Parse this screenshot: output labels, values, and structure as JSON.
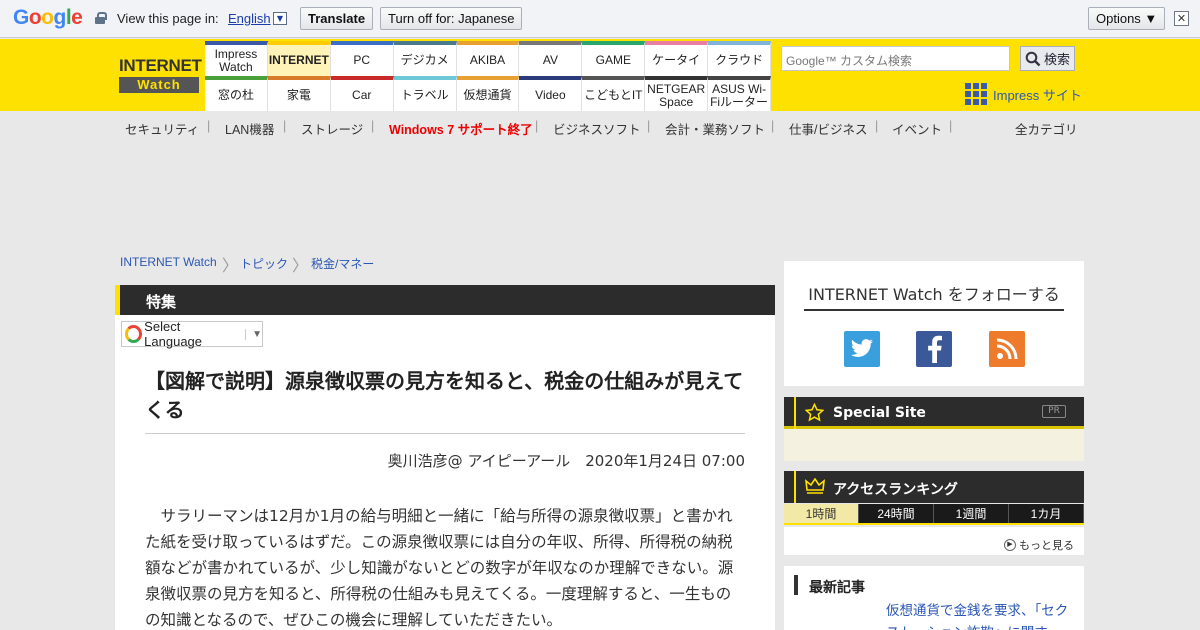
{
  "translate_bar": {
    "logo": [
      "G",
      "o",
      "o",
      "g",
      "l",
      "e"
    ],
    "view_label": "View this page in:",
    "language": "English",
    "translate_button": "Translate",
    "turn_off_button": "Turn off for: Japanese",
    "options_button": "Options ▼",
    "close_glyph": "✕"
  },
  "header": {
    "logo_top": "INTERNET",
    "logo_bottom": "Watch",
    "nav_row1": [
      {
        "label": "Impress Watch",
        "color": "#3a5aa8"
      },
      {
        "label": "INTERNET",
        "color": "#ffcc00",
        "active": true
      },
      {
        "label": "PC",
        "color": "#3a6fc4"
      },
      {
        "label": "デジカメ",
        "color": "#4a7a8c"
      },
      {
        "label": "AKIBA",
        "color": "#e8a030"
      },
      {
        "label": "AV",
        "color": "#777777"
      },
      {
        "label": "GAME",
        "color": "#2aa66a"
      },
      {
        "label": "ケータイ",
        "color": "#e87fa0"
      },
      {
        "label": "クラウド",
        "color": "#7fb3d8"
      }
    ],
    "nav_row2": [
      {
        "label": "窓の杜",
        "color": "#4aa03a"
      },
      {
        "label": "家電",
        "color": "#d87a2a"
      },
      {
        "label": "Car",
        "color": "#c82a2a"
      },
      {
        "label": "トラベル",
        "color": "#6ec8d8"
      },
      {
        "label": "仮想通貨",
        "color": "#e8a030"
      },
      {
        "label": "Video",
        "color": "#2a3a7a"
      },
      {
        "label": "こどもとIT",
        "color": "#555555"
      },
      {
        "label": "NETGEAR Space",
        "color": "#333333"
      },
      {
        "label": "ASUS Wi-Fiルーター",
        "color": "#444444"
      }
    ],
    "search_placeholder": "Google™ カスタム検索",
    "search_button": "検索",
    "impress_link": "Impress サイト"
  },
  "categories": [
    "セキュリティ",
    "LAN機器",
    "ストレージ",
    "Windows 7 サポート終了",
    "ビジネスソフト",
    "会計・業務ソフト",
    "仕事/ビジネス",
    "イベント"
  ],
  "all_categories": "全カテゴリ",
  "breadcrumb": [
    "INTERNET Watch",
    "トピック",
    "税金/マネー"
  ],
  "article": {
    "section": "特集",
    "language_select": "Select Language",
    "title": "【図解で説明】源泉徴収票の見方を知ると、税金の仕組みが見えてくる",
    "byline": "奥川浩彦@ アイピーアール　2020年1月24日 07:00",
    "body": "サラリーマンは12月か1月の給与明細と一緒に「給与所得の源泉徴収票」と書かれた紙を受け取っているはずだ。この源泉徴収票には自分の年収、所得、所得税の納税額などが書かれているが、少し知識がないとどの数字が年収なのか理解できない。源泉徴収票の見方を知ると、所得税の仕組みも見えてくる。一度理解すると、一生ものの知識となるので、ぜひこの機会に理解していただきたい。"
  },
  "sidebar": {
    "follow_title": "INTERNET Watch をフォローする",
    "sns": [
      {
        "name": "twitter-icon",
        "glyph": "🐦"
      },
      {
        "name": "facebook-icon",
        "glyph": "f"
      },
      {
        "name": "rss-icon",
        "glyph": "))"
      }
    ],
    "special_site": "Special Site",
    "pr": "PR",
    "ranking_title": "アクセスランキング",
    "ranking_tabs": [
      "1時間",
      "24時間",
      "1週間",
      "1カ月"
    ],
    "more": "もっと見る",
    "latest_title": "最新記事",
    "latest_item": "仮想通貨で金銭を要求、「セクストーション詐欺」に関す"
  }
}
